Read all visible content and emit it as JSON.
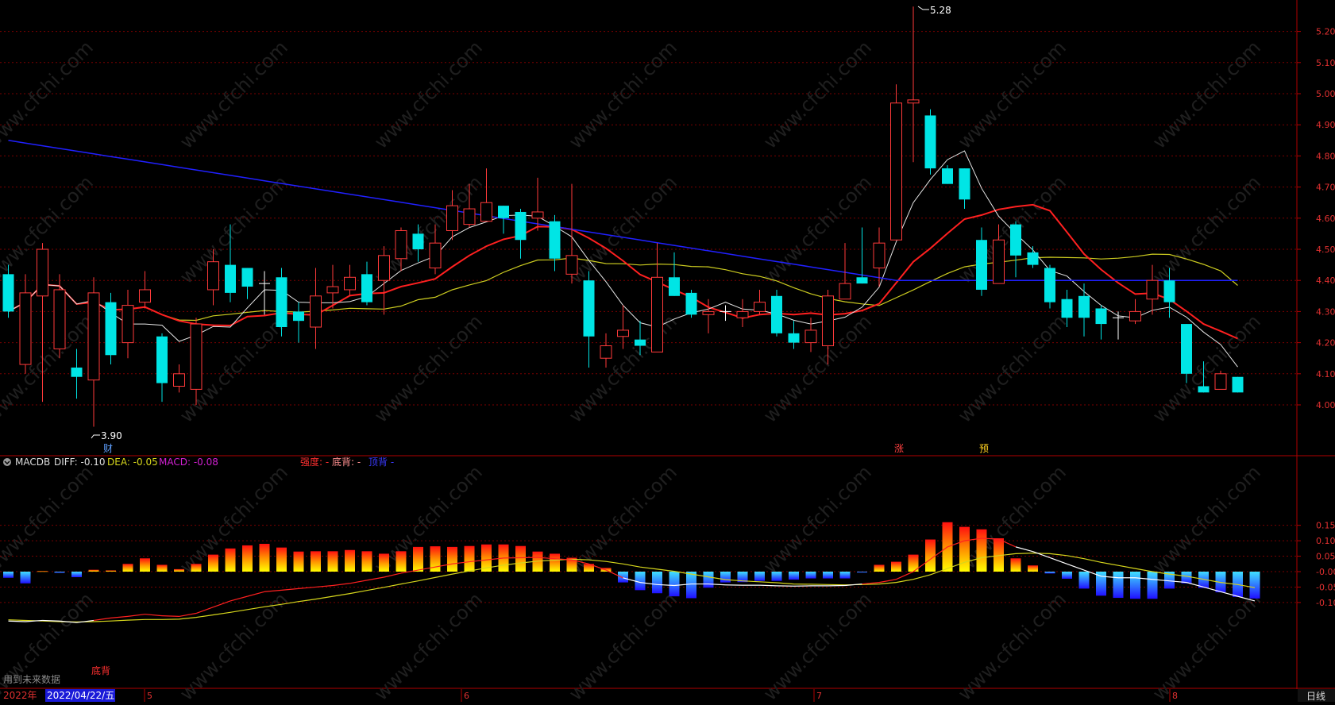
{
  "colors": {
    "up": "#ff3a3a",
    "down": "#00e5e5",
    "ma5": "#e6e6e6",
    "ma10": "#ff2020",
    "ma20": "#cccc20",
    "ma60": "#2020ff",
    "grid": "#7a0000",
    "axis_text": "#e03030",
    "dea": "#d6d61c",
    "macd_label": "#d020d0"
  },
  "price_axis": {
    "ticks": [
      "5.20",
      "5.10",
      "5.00",
      "4.90",
      "4.80",
      "4.70",
      "4.60",
      "4.50",
      "4.40",
      "4.30",
      "4.20",
      "4.10",
      "4.00"
    ]
  },
  "macd_axis": {
    "ticks": [
      "0.15",
      "0.10",
      "0.05",
      "-0.00",
      "-0.05",
      "-0.10"
    ]
  },
  "header": {
    "macd_badge_icon": "circle-chevron-icon",
    "indicator_name": "MACDB",
    "diff_text": "DIFF: -0.10",
    "dea_text": "DEA: -0.05",
    "macd_text": "MACD: -0.08",
    "strength_label": "强度: -",
    "divergence_label": "底背: -",
    "crest_label": "顶背 -"
  },
  "markers": {
    "high_label": "5.28",
    "low_label": "3.90",
    "fin_mark": "财",
    "zhang_mark": "涨",
    "yu_mark": "预",
    "divergence_mark": "底背"
  },
  "footer": {
    "year_label": "2022年",
    "cursor_date": "2022/04/22/五",
    "months": [
      "5",
      "6",
      "7",
      "8"
    ],
    "period_button": "日线",
    "future_data_label": "用到未来数据"
  },
  "watermark": "www.cfchi.com",
  "chart_data": [
    {
      "type": "candlestick",
      "title": "",
      "ylim": [
        3.85,
        5.3
      ],
      "y_ticks": [
        4.0,
        4.1,
        4.2,
        4.3,
        4.4,
        4.5,
        4.6,
        4.7,
        4.8,
        4.9,
        5.0,
        5.1,
        5.2
      ],
      "period": "日线",
      "annotations": {
        "high": 5.28,
        "low": 3.9
      },
      "candles": [
        [
          4.42,
          4.3,
          4.45,
          4.28
        ],
        [
          4.13,
          4.36,
          4.42,
          4.1
        ],
        [
          4.35,
          4.5,
          4.52,
          4.01
        ],
        [
          4.18,
          4.37,
          4.42,
          4.15
        ],
        [
          4.12,
          4.09,
          4.18,
          4.02
        ],
        [
          4.08,
          4.36,
          4.41,
          3.93
        ],
        [
          4.33,
          4.16,
          4.36,
          4.13
        ],
        [
          4.2,
          4.32,
          4.37,
          4.15
        ],
        [
          4.33,
          4.37,
          4.43,
          4.31
        ],
        [
          4.22,
          4.07,
          4.23,
          4.01
        ],
        [
          4.06,
          4.1,
          4.13,
          4.04
        ],
        [
          4.05,
          4.26,
          4.28,
          4.0
        ],
        [
          4.37,
          4.46,
          4.5,
          4.32
        ],
        [
          4.45,
          4.36,
          4.58,
          4.33
        ],
        [
          4.44,
          4.38,
          4.44,
          4.34
        ],
        [
          4.39,
          4.39,
          4.43,
          4.29
        ],
        [
          4.41,
          4.25,
          4.44,
          4.22
        ],
        [
          4.3,
          4.27,
          4.33,
          4.2
        ],
        [
          4.25,
          4.35,
          4.44,
          4.18
        ],
        [
          4.36,
          4.38,
          4.45,
          4.31
        ],
        [
          4.37,
          4.41,
          4.45,
          4.35
        ],
        [
          4.42,
          4.33,
          4.46,
          4.32
        ],
        [
          4.4,
          4.48,
          4.51,
          4.29
        ],
        [
          4.47,
          4.56,
          4.57,
          4.43
        ],
        [
          4.55,
          4.5,
          4.58,
          4.46
        ],
        [
          4.44,
          4.52,
          4.58,
          4.42
        ],
        [
          4.56,
          4.64,
          4.69,
          4.53
        ],
        [
          4.58,
          4.63,
          4.71,
          4.57
        ],
        [
          4.59,
          4.65,
          4.76,
          4.59
        ],
        [
          4.64,
          4.6,
          4.64,
          4.55
        ],
        [
          4.62,
          4.53,
          4.63,
          4.47
        ],
        [
          4.6,
          4.62,
          4.73,
          4.56
        ],
        [
          4.59,
          4.47,
          4.61,
          4.43
        ],
        [
          4.42,
          4.48,
          4.71,
          4.39
        ],
        [
          4.4,
          4.22,
          4.43,
          4.12
        ],
        [
          4.15,
          4.19,
          4.23,
          4.12
        ],
        [
          4.22,
          4.24,
          4.32,
          4.18
        ],
        [
          4.21,
          4.19,
          4.27,
          4.16
        ],
        [
          4.17,
          4.41,
          4.52,
          4.17
        ],
        [
          4.41,
          4.35,
          4.49,
          4.35
        ],
        [
          4.36,
          4.29,
          4.37,
          4.28
        ],
        [
          4.29,
          4.3,
          4.34,
          4.23
        ],
        [
          4.3,
          4.3,
          4.32,
          4.27
        ],
        [
          4.28,
          4.3,
          4.34,
          4.25
        ],
        [
          4.3,
          4.33,
          4.37,
          4.29
        ],
        [
          4.35,
          4.23,
          4.37,
          4.22
        ],
        [
          4.23,
          4.2,
          4.27,
          4.18
        ],
        [
          4.2,
          4.24,
          4.28,
          4.17
        ],
        [
          4.19,
          4.35,
          4.37,
          4.13
        ],
        [
          4.34,
          4.39,
          4.52,
          4.34
        ],
        [
          4.41,
          4.39,
          4.57,
          4.39
        ],
        [
          4.44,
          4.52,
          4.57,
          4.38
        ],
        [
          4.53,
          4.97,
          5.03,
          4.53
        ],
        [
          4.97,
          4.98,
          5.28,
          4.78
        ],
        [
          4.93,
          4.76,
          4.95,
          4.74
        ],
        [
          4.76,
          4.71,
          4.77,
          4.71
        ],
        [
          4.76,
          4.66,
          4.76,
          4.63
        ],
        [
          4.53,
          4.37,
          4.57,
          4.35
        ],
        [
          4.39,
          4.53,
          4.58,
          4.39
        ],
        [
          4.58,
          4.48,
          4.59,
          4.41
        ],
        [
          4.49,
          4.45,
          4.51,
          4.44
        ],
        [
          4.44,
          4.33,
          4.45,
          4.31
        ],
        [
          4.34,
          4.28,
          4.37,
          4.25
        ],
        [
          4.35,
          4.28,
          4.39,
          4.22
        ],
        [
          4.31,
          4.26,
          4.32,
          4.21
        ],
        [
          4.28,
          4.28,
          4.3,
          4.21
        ],
        [
          4.27,
          4.3,
          4.34,
          4.26
        ],
        [
          4.34,
          4.4,
          4.45,
          4.29
        ],
        [
          4.4,
          4.33,
          4.44,
          4.28
        ],
        [
          4.26,
          4.1,
          4.26,
          4.07
        ],
        [
          4.06,
          4.04,
          4.14,
          4.04
        ],
        [
          4.05,
          4.1,
          4.11,
          4.05
        ],
        [
          4.09,
          4.04,
          4.09,
          4.04
        ]
      ]
    },
    {
      "type": "bar",
      "title": "MACDB",
      "ylim": [
        -0.12,
        0.17
      ],
      "y_ticks": [
        0.15,
        0.1,
        0.05,
        0.0,
        -0.05,
        -0.1
      ],
      "macd_hist": [
        -0.02,
        -0.038,
        0.002,
        -0.004,
        -0.018,
        0.006,
        0.004,
        0.025,
        0.043,
        0.022,
        0.008,
        0.025,
        0.055,
        0.075,
        0.085,
        0.09,
        0.078,
        0.065,
        0.066,
        0.066,
        0.07,
        0.066,
        0.058,
        0.066,
        0.08,
        0.082,
        0.08,
        0.083,
        0.088,
        0.088,
        0.083,
        0.065,
        0.058,
        0.045,
        0.025,
        0.012,
        -0.035,
        -0.06,
        -0.07,
        -0.08,
        -0.086,
        -0.052,
        -0.035,
        -0.034,
        -0.03,
        -0.03,
        -0.026,
        -0.022,
        -0.022,
        -0.022,
        -0.003,
        0.022,
        0.032,
        0.055,
        0.104,
        0.16,
        0.145,
        0.137,
        0.108,
        0.043,
        0.02,
        -0.006,
        -0.023,
        -0.055,
        -0.078,
        -0.085,
        -0.088,
        -0.088,
        -0.055,
        -0.038,
        -0.053,
        -0.067,
        -0.082,
        -0.087
      ],
      "series": [
        {
          "name": "DIFF",
          "values": [
            -0.16,
            -0.162,
            -0.158,
            -0.16,
            -0.165,
            -0.158,
            -0.15,
            -0.145,
            -0.138,
            -0.143,
            -0.145,
            -0.135,
            -0.115,
            -0.095,
            -0.08,
            -0.065,
            -0.06,
            -0.055,
            -0.05,
            -0.045,
            -0.038,
            -0.028,
            -0.018,
            -0.005,
            0.005,
            0.015,
            0.025,
            0.032,
            0.038,
            0.044,
            0.045,
            0.046,
            0.042,
            0.038,
            0.025,
            0.005,
            -0.02,
            -0.035,
            -0.042,
            -0.045,
            -0.04,
            -0.04,
            -0.043,
            -0.044,
            -0.044,
            -0.046,
            -0.047,
            -0.046,
            -0.046,
            -0.045,
            -0.04,
            -0.035,
            -0.025,
            0.0,
            0.04,
            0.08,
            0.1,
            0.108,
            0.105,
            0.08,
            0.065,
            0.045,
            0.025,
            0.005,
            -0.015,
            -0.02,
            -0.02,
            -0.025,
            -0.03,
            -0.035,
            -0.05,
            -0.065,
            -0.08,
            -0.095
          ]
        },
        {
          "name": "DEA",
          "values": [
            -0.156,
            -0.158,
            -0.16,
            -0.162,
            -0.163,
            -0.162,
            -0.16,
            -0.157,
            -0.155,
            -0.155,
            -0.154,
            -0.148,
            -0.14,
            -0.132,
            -0.123,
            -0.114,
            -0.106,
            -0.097,
            -0.089,
            -0.08,
            -0.071,
            -0.061,
            -0.051,
            -0.04,
            -0.03,
            -0.019,
            -0.008,
            0.002,
            0.012,
            0.021,
            0.028,
            0.034,
            0.037,
            0.04,
            0.038,
            0.033,
            0.025,
            0.015,
            0.008,
            0.001,
            -0.008,
            -0.017,
            -0.026,
            -0.03,
            -0.033,
            -0.036,
            -0.04,
            -0.041,
            -0.042,
            -0.043,
            -0.042,
            -0.04,
            -0.035,
            -0.025,
            -0.01,
            0.01,
            0.03,
            0.045,
            0.052,
            0.058,
            0.06,
            0.058,
            0.052,
            0.042,
            0.03,
            0.02,
            0.01,
            0.0,
            -0.008,
            -0.015,
            -0.025,
            -0.035,
            -0.042,
            -0.052
          ]
        }
      ]
    }
  ]
}
